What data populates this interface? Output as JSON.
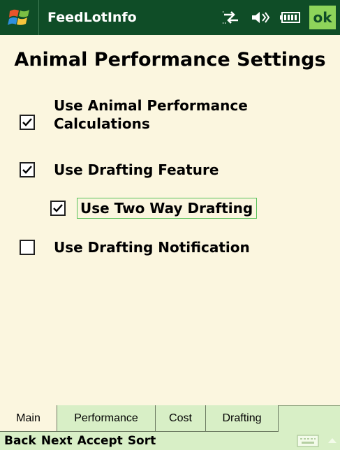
{
  "titlebar": {
    "app_title": "FeedLotInfo",
    "ok_label": "ok",
    "start_icon": "windows-flag-icon",
    "status_icons": [
      "connectivity-icon",
      "speaker-icon",
      "battery-icon"
    ]
  },
  "page": {
    "title": "Animal Performance Settings"
  },
  "options": [
    {
      "label": "Use Animal Performance Calculations",
      "checked": true
    },
    {
      "label": "Use Drafting Feature",
      "checked": true
    },
    {
      "label": "Use Two Way Drafting",
      "checked": true,
      "focused": true
    },
    {
      "label": "Use Drafting Notification",
      "checked": false
    }
  ],
  "tabs": [
    {
      "label": "Main",
      "active": true
    },
    {
      "label": "Performance",
      "active": false
    },
    {
      "label": "Cost",
      "active": false
    },
    {
      "label": "Drafting",
      "active": false
    }
  ],
  "menubar": {
    "items": [
      "Back",
      "Next",
      "Accept",
      "Sort"
    ],
    "keyboard_icon": "keyboard-icon",
    "arrow_icon": "up-arrow-icon"
  },
  "colors": {
    "titlebar_bg": "#0f4d27",
    "body_bg": "#fbf6df",
    "bar_bg": "#d8efc6",
    "ok_bg": "#8ed45a",
    "focus_border": "#59c25a"
  }
}
